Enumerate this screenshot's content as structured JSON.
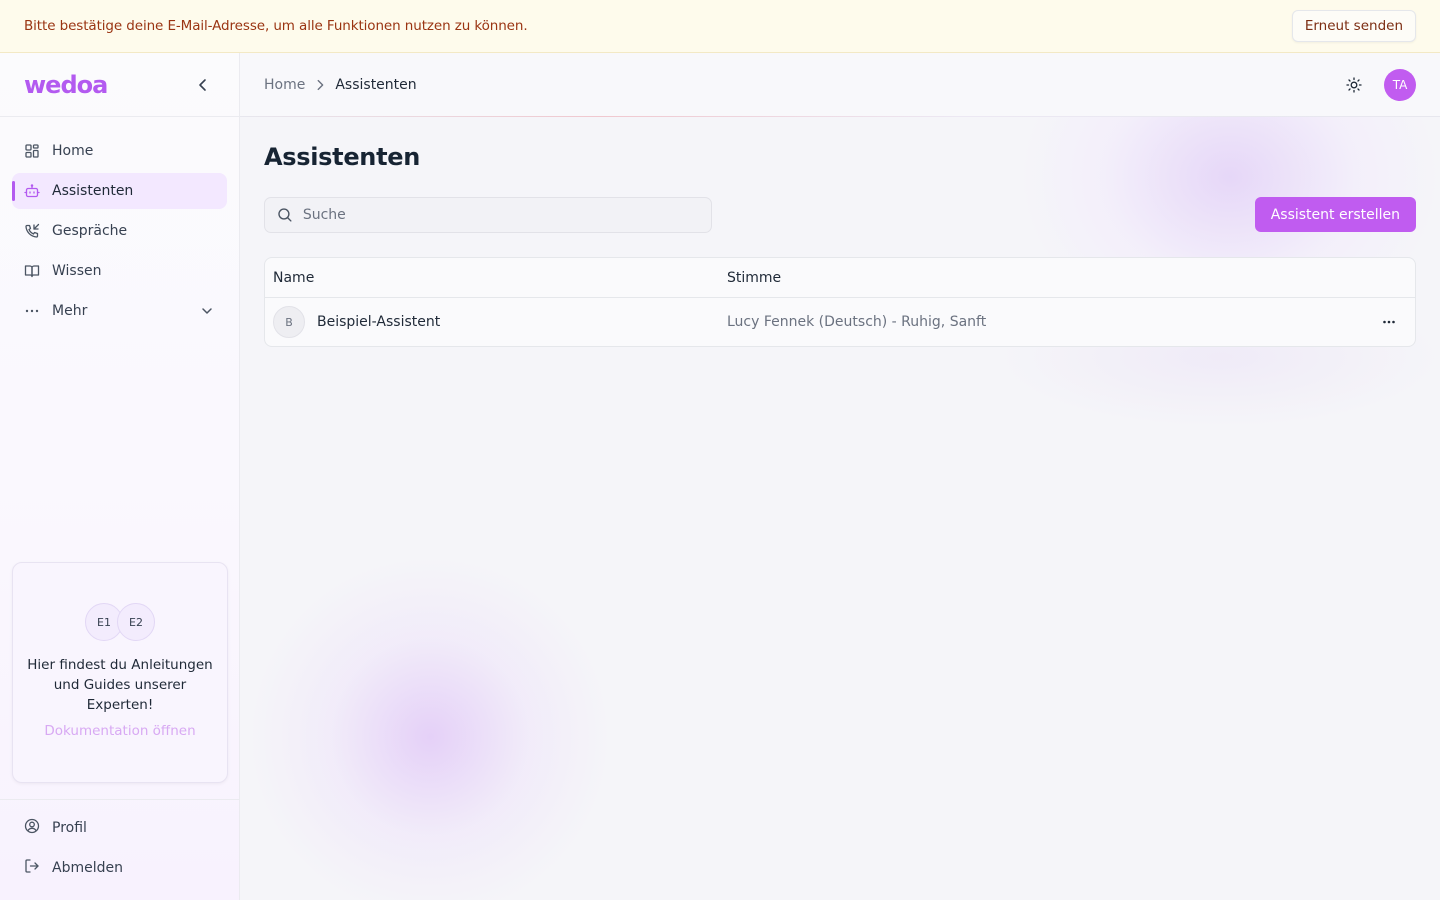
{
  "banner": {
    "message": "Bitte bestätige deine E-Mail-Adresse, um alle Funktionen nutzen zu können.",
    "resend_label": "Erneut senden"
  },
  "sidebar": {
    "logo": "wedoa",
    "items": [
      {
        "label": "Home",
        "icon": "dashboard-grid-icon"
      },
      {
        "label": "Assistenten",
        "icon": "bot-icon",
        "active": true
      },
      {
        "label": "Gespräche",
        "icon": "phone-call-icon"
      },
      {
        "label": "Wissen",
        "icon": "book-open-icon"
      },
      {
        "label": "Mehr",
        "icon": "ellipsis-icon",
        "expandable": true
      }
    ],
    "docs_card": {
      "avatars": [
        "E1",
        "E2"
      ],
      "text": "Hier findest du Anleitungen und Guides unserer Experten!",
      "link": "Dokumentation öffnen"
    },
    "footer": [
      {
        "label": "Profil",
        "icon": "user-circle-icon"
      },
      {
        "label": "Abmelden",
        "icon": "logout-icon"
      }
    ]
  },
  "header": {
    "breadcrumb": {
      "home": "Home",
      "current": "Assistenten"
    },
    "user_initials": "TA"
  },
  "main": {
    "title": "Assistenten",
    "search_placeholder": "Suche",
    "create_label": "Assistent erstellen",
    "table": {
      "columns": [
        "Name",
        "Stimme"
      ],
      "rows": [
        {
          "initial": "B",
          "name": "Beispiel-Assistent",
          "voice": "Lucy Fennek (Deutsch) - Ruhig, Sanft"
        }
      ]
    }
  },
  "colors": {
    "accent": "#c05cf0",
    "banner_bg": "#fefbec",
    "banner_text": "#9a3412"
  }
}
